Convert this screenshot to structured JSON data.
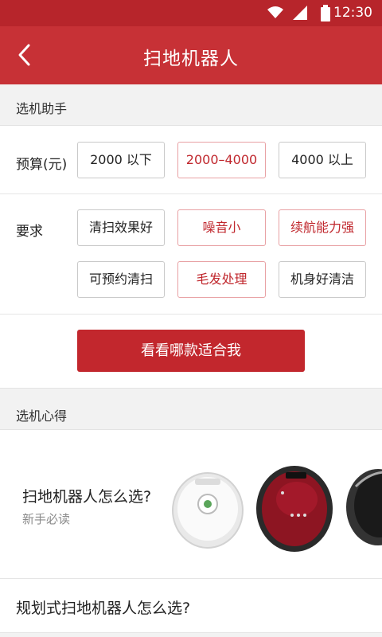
{
  "status_bar": {
    "time": "12:30",
    "wifi_icon": "wifi-icon",
    "signal_icon": "signal-icon",
    "battery_icon": "battery-icon"
  },
  "app_bar": {
    "title": "扫地机器人",
    "back_icon": "back-arrow-icon"
  },
  "helper": {
    "header": "选机助手",
    "budget": {
      "label": "预算(元)",
      "options": [
        {
          "label": "2000 以下",
          "selected": false
        },
        {
          "label": "2000–4000",
          "selected": true
        },
        {
          "label": "4000 以上",
          "selected": false
        }
      ]
    },
    "requirements": {
      "label": "要求",
      "options": [
        {
          "label": "清扫效果好",
          "selected": false
        },
        {
          "label": "噪音小",
          "selected": true
        },
        {
          "label": "续航能力强",
          "selected": true
        },
        {
          "label": "可预约清扫",
          "selected": false
        },
        {
          "label": "毛发处理",
          "selected": true
        },
        {
          "label": "机身好清洁",
          "selected": false
        }
      ]
    },
    "cta_label": "看看哪款适合我"
  },
  "tips": {
    "header": "选机心得",
    "articles": [
      {
        "title": "扫地机器人怎么选?",
        "subtitle": "新手必读"
      },
      {
        "title": "规划式扫地机器人怎么选?"
      }
    ]
  },
  "colors": {
    "status_bar": "#b7252b",
    "app_bar": "#c73136",
    "accent": "#c2272d",
    "selected_border": "#e8a1a4"
  }
}
